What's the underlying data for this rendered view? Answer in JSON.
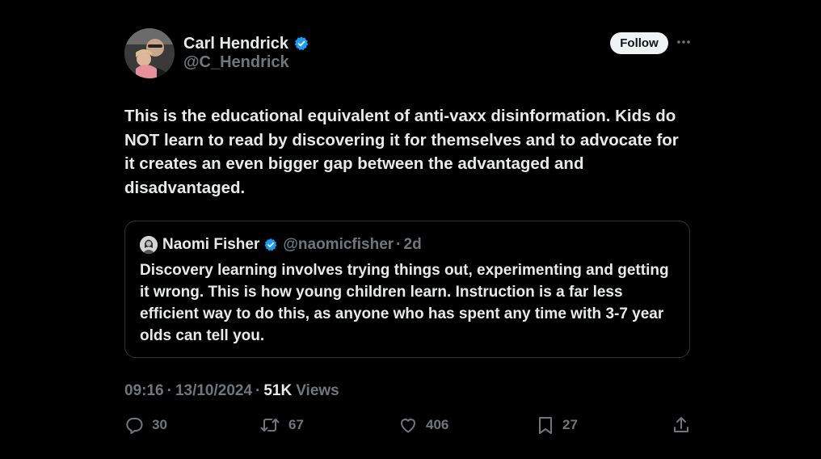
{
  "author": {
    "display_name": "Carl Hendrick",
    "handle": "@C_Hendrick",
    "verified": true
  },
  "follow_label": "Follow",
  "more_icon": "more-horizontal-icon",
  "tweet_text": "This is the educational equivalent of anti-vaxx disinformation. Kids do NOT learn to read by discovering it for themselves and to advocate for it creates an even bigger gap between the advantaged and disadvantaged.",
  "quote": {
    "display_name": "Naomi Fisher",
    "handle": "@naomicfisher",
    "separator": "·",
    "time": "2d",
    "verified": true,
    "text": "Discovery learning involves trying things out, experimenting and getting it wrong. This is how young children learn. Instruction is a far less efficient way to do this, as anyone who has spent any time with 3-7 year olds can tell you."
  },
  "meta": {
    "time": "09:16",
    "date": "13/10/2024",
    "separator": "·",
    "views_count": "51K",
    "views_label": "Views"
  },
  "actions": {
    "replies": "30",
    "reposts": "67",
    "likes": "406",
    "bookmarks": "27"
  },
  "colors": {
    "background": "#000000",
    "primary_text": "#e7e9ea",
    "secondary_text": "#71767b",
    "verified_blue": "#1d9bf0",
    "border": "#2f3336"
  }
}
